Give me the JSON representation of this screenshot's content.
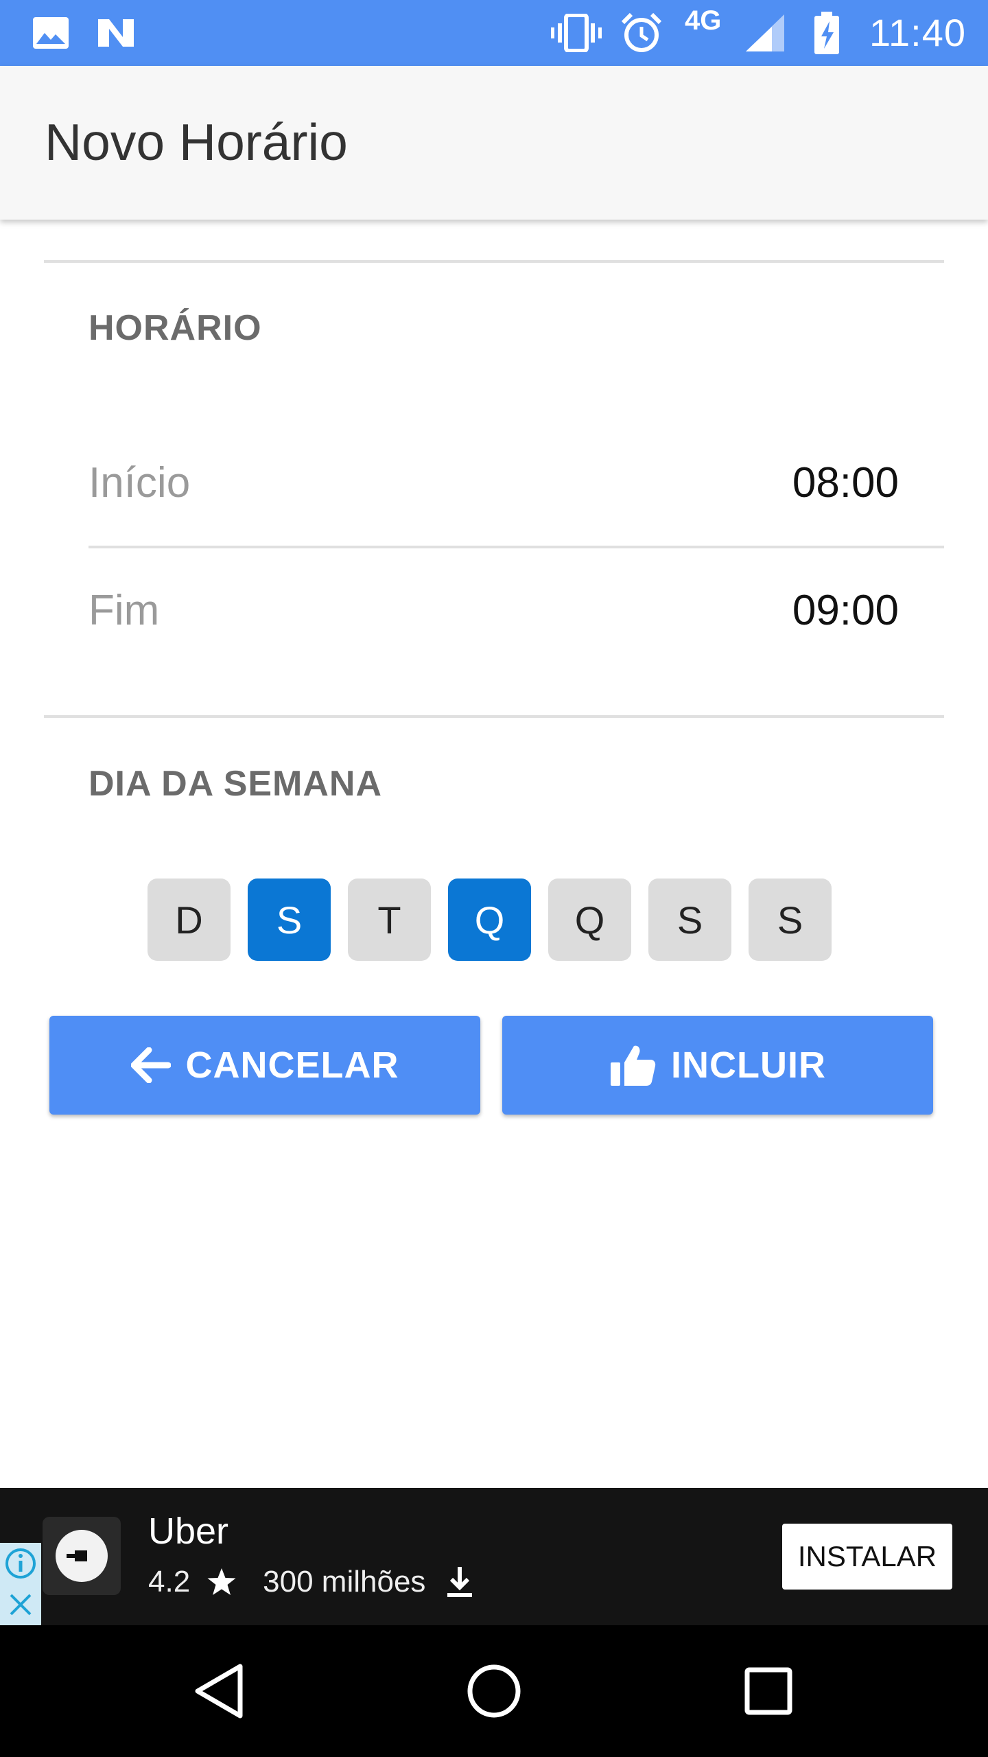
{
  "status_bar": {
    "time": "11:40",
    "network": "4G",
    "icons": [
      "image-icon",
      "n-notification-icon",
      "vibrate-icon",
      "alarm-icon",
      "signal-icon",
      "battery-charging-icon"
    ]
  },
  "app_bar": {
    "title": "Novo Horário"
  },
  "schedule": {
    "section_title": "HORÁRIO",
    "start_label": "Início",
    "start_value": "08:00",
    "end_label": "Fim",
    "end_value": "09:00"
  },
  "weekdays": {
    "section_title": "DIA DA SEMANA",
    "days": [
      {
        "label": "D",
        "selected": false
      },
      {
        "label": "S",
        "selected": true
      },
      {
        "label": "T",
        "selected": false
      },
      {
        "label": "Q",
        "selected": true
      },
      {
        "label": "Q",
        "selected": false
      },
      {
        "label": "S",
        "selected": false
      },
      {
        "label": "S",
        "selected": false
      }
    ]
  },
  "actions": {
    "cancel_label": "CANCELAR",
    "cancel_icon": "arrow-left-icon",
    "include_label": "INCLUIR",
    "include_icon": "thumbs-up-icon"
  },
  "ad": {
    "app_name": "Uber",
    "rating": "4.2",
    "downloads": "300 milhões",
    "install_label": "INSTALAR"
  },
  "colors": {
    "status_bar": "#508ff3",
    "primary_button": "#4f8ef5",
    "day_selected": "#0b77d4",
    "day_unselected": "#dcdcdc"
  }
}
